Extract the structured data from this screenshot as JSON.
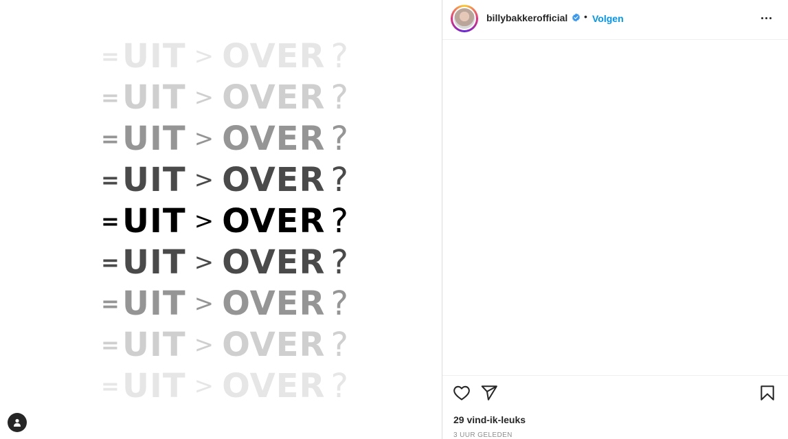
{
  "post": {
    "lines": [
      {
        "eq": "=",
        "word1": "UIT",
        "gt": ">",
        "word2": "OVER",
        "qm": "?",
        "color": "#e6e6e6"
      },
      {
        "eq": "=",
        "word1": "UIT",
        "gt": ">",
        "word2": "OVER",
        "qm": "?",
        "color": "#cfcfcf"
      },
      {
        "eq": "=",
        "word1": "UIT",
        "gt": ">",
        "word2": "OVER",
        "qm": "?",
        "color": "#959595"
      },
      {
        "eq": "=",
        "word1": "UIT",
        "gt": ">",
        "word2": "OVER",
        "qm": "?",
        "color": "#4a4a4a"
      },
      {
        "eq": "=",
        "word1": "UIT",
        "gt": ">",
        "word2": "OVER",
        "qm": "?",
        "color": "#000000"
      },
      {
        "eq": "=",
        "word1": "UIT",
        "gt": ">",
        "word2": "OVER",
        "qm": "?",
        "color": "#4a4a4a"
      },
      {
        "eq": "=",
        "word1": "UIT",
        "gt": ">",
        "word2": "OVER",
        "qm": "?",
        "color": "#959595"
      },
      {
        "eq": "=",
        "word1": "UIT",
        "gt": ">",
        "word2": "OVER",
        "qm": "?",
        "color": "#cfcfcf"
      },
      {
        "eq": "=",
        "word1": "UIT",
        "gt": ">",
        "word2": "OVER",
        "qm": "?",
        "color": "#e6e6e6"
      }
    ]
  },
  "header": {
    "username": "billybakkerofficial",
    "separator": "•",
    "follow_label": "Volgen",
    "verified_icon": "verified-badge-icon",
    "more_icon": "more-options-icon"
  },
  "actions": {
    "like_icon": "heart-icon",
    "share_icon": "paper-plane-icon",
    "save_icon": "bookmark-icon"
  },
  "likes_text": "29 vind-ik-leuks",
  "timestamp": "3 UUR GELEDEN",
  "colors": {
    "accent": "#0095f6",
    "text": "#262626",
    "muted": "#8e8e8e"
  }
}
